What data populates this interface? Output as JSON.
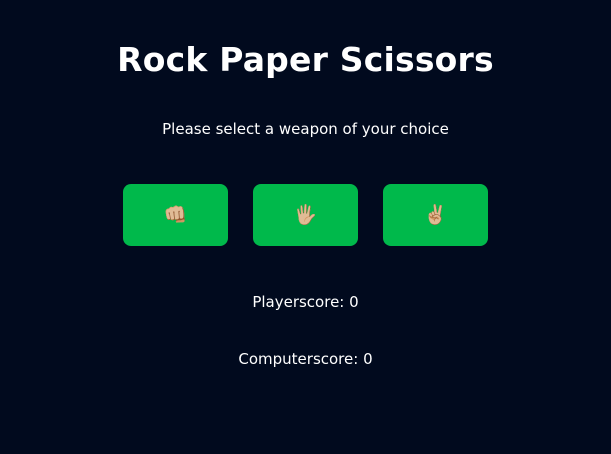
{
  "app": {
    "title": "Rock Paper Scissors",
    "instruction": "Please select a weapon of your choice"
  },
  "weapons": [
    {
      "name": "rock",
      "icon": "fist-icon",
      "glyph": "👊🏼"
    },
    {
      "name": "paper",
      "icon": "raised-hand-icon",
      "glyph": "🖐🏼"
    },
    {
      "name": "scissors",
      "icon": "victory-hand-icon",
      "glyph": "✌🏼"
    }
  ],
  "scores": {
    "player_label": "Playerscore: 0",
    "computer_label": "Computerscore: 0"
  },
  "colors": {
    "background": "#010a1e",
    "button": "#00b94b",
    "text": "#ffffff"
  }
}
